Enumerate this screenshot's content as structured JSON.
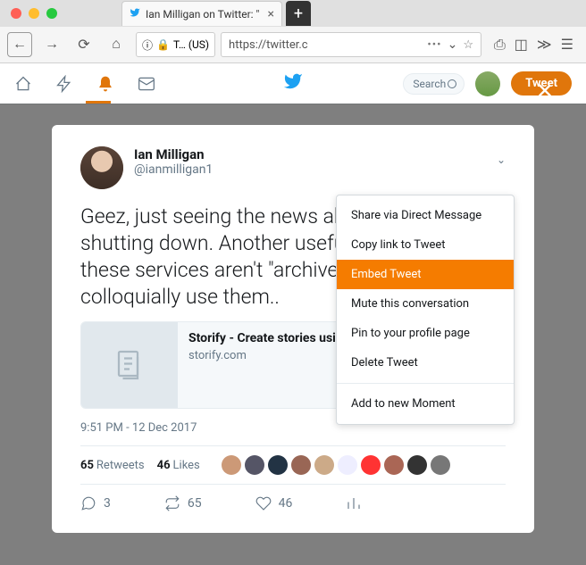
{
  "browser": {
    "tab_title": "Ian Milligan on Twitter: \"Geez, j…",
    "url_display": "https://twitter.c",
    "ssl_label": "T… (US)"
  },
  "twitter_nav": {
    "search_placeholder": "Search",
    "tweet_button": "Tweet"
  },
  "tweet": {
    "display_name": "Ian Milligan",
    "handle": "@ianmilligan1",
    "text": "Geez, just seeing the news about Storify shutting down. Another useful reminder that these services aren't \"archives\" in the way folks colloquially use them..",
    "card": {
      "title": "Storify - Create stories using social media",
      "domain": "storify.com"
    },
    "timestamp": "9:51 PM - 12 Dec 2017",
    "retweets_count": "65",
    "retweets_label": "Retweets",
    "likes_count": "46",
    "likes_label": "Likes",
    "reply_count": "3",
    "rt_action": "65",
    "like_action": "46"
  },
  "dropdown": {
    "items": [
      "Share via Direct Message",
      "Copy link to Tweet",
      "Embed Tweet",
      "Mute this conversation",
      "Pin to your profile page",
      "Delete Tweet"
    ],
    "moment": "Add to new Moment",
    "highlighted_index": 2
  }
}
